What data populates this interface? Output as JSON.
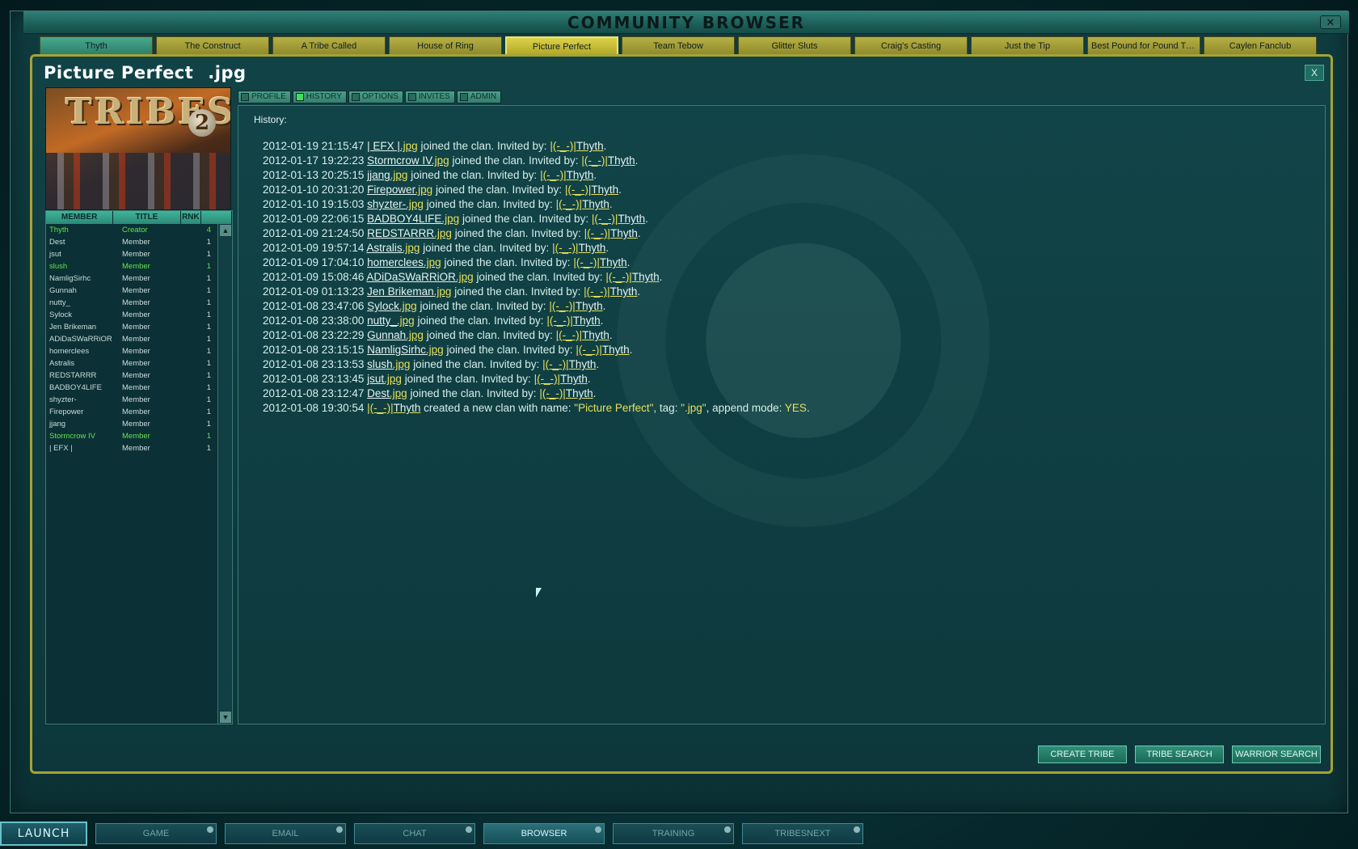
{
  "window": {
    "title": "COMMUNITY BROWSER"
  },
  "tribe_tabs": [
    "Thyth",
    "The Construct",
    "A Tribe Called",
    "House of Ring",
    "Picture Perfect",
    "Team Tebow",
    "Glitter Sluts",
    "Craig's Casting",
    "Just the Tip",
    "Best Pound for Pound Trib...",
    "Caylen Fanclub"
  ],
  "panel": {
    "name": "Picture Perfect",
    "tag": ".jpg",
    "close_label": "X"
  },
  "logo": {
    "text": "TRIBES",
    "number": "2"
  },
  "members": {
    "headers": {
      "member": "MEMBER",
      "title": "TITLE",
      "rank": "RNK"
    },
    "rows": [
      {
        "name": "Thyth",
        "title": "Creator",
        "rank": "4",
        "highlight": true
      },
      {
        "name": "Dest",
        "title": "Member",
        "rank": "1",
        "highlight": false
      },
      {
        "name": "jsut",
        "title": "Member",
        "rank": "1",
        "highlight": false
      },
      {
        "name": "slush",
        "title": "Member",
        "rank": "1",
        "highlight": true
      },
      {
        "name": "NamligSirhc",
        "title": "Member",
        "rank": "1",
        "highlight": false
      },
      {
        "name": "Gunnah",
        "title": "Member",
        "rank": "1",
        "highlight": false
      },
      {
        "name": "nutty_",
        "title": "Member",
        "rank": "1",
        "highlight": false
      },
      {
        "name": "Sylock",
        "title": "Member",
        "rank": "1",
        "highlight": false
      },
      {
        "name": "Jen Brikeman",
        "title": "Member",
        "rank": "1",
        "highlight": false
      },
      {
        "name": "ADiDaSWaRRiOR",
        "title": "Member",
        "rank": "1",
        "highlight": false
      },
      {
        "name": "homerclees",
        "title": "Member",
        "rank": "1",
        "highlight": false
      },
      {
        "name": "Astralis",
        "title": "Member",
        "rank": "1",
        "highlight": false
      },
      {
        "name": "REDSTARRR",
        "title": "Member",
        "rank": "1",
        "highlight": false
      },
      {
        "name": "BADBOY4LIFE",
        "title": "Member",
        "rank": "1",
        "highlight": false
      },
      {
        "name": "shyzter-",
        "title": "Member",
        "rank": "1",
        "highlight": false
      },
      {
        "name": "Firepower",
        "title": "Member",
        "rank": "1",
        "highlight": false
      },
      {
        "name": "jjang",
        "title": "Member",
        "rank": "1",
        "highlight": false
      },
      {
        "name": "Stormcrow IV",
        "title": "Member",
        "rank": "1",
        "highlight": true
      },
      {
        "name": "| EFX |",
        "title": "Member",
        "rank": "1",
        "highlight": false
      }
    ]
  },
  "subtabs": [
    {
      "label": "PROFILE",
      "active": false
    },
    {
      "label": "HISTORY",
      "active": true
    },
    {
      "label": "OPTIONS",
      "active": false
    },
    {
      "label": "INVITES",
      "active": false
    },
    {
      "label": "ADMIN",
      "active": false
    }
  ],
  "history": {
    "label": "History:",
    "inviter_prefix": "|(-_-)|",
    "inviter_name": "Thyth",
    "entries": [
      {
        "time": "2012-01-19 21:15:47",
        "user": "| EFX |",
        "tag": ".jpg"
      },
      {
        "time": "2012-01-17 19:22:23",
        "user": "Stormcrow IV",
        "tag": ".jpg"
      },
      {
        "time": "2012-01-13 20:25:15",
        "user": "jjang",
        "tag": ".jpg"
      },
      {
        "time": "2012-01-10 20:31:20",
        "user": "Firepower",
        "tag": ".jpg"
      },
      {
        "time": "2012-01-10 19:15:03",
        "user": "shyzter-",
        "tag": ".jpg"
      },
      {
        "time": "2012-01-09 22:06:15",
        "user": "BADBOY4LIFE",
        "tag": ".jpg"
      },
      {
        "time": "2012-01-09 21:24:50",
        "user": "REDSTARRR",
        "tag": ".jpg"
      },
      {
        "time": "2012-01-09 19:57:14",
        "user": "Astralis",
        "tag": ".jpg"
      },
      {
        "time": "2012-01-09 17:04:10",
        "user": "homerclees",
        "tag": ".jpg"
      },
      {
        "time": "2012-01-09 15:08:46",
        "user": "ADiDaSWaRRiOR",
        "tag": ".jpg"
      },
      {
        "time": "2012-01-09 01:13:23",
        "user": "Jen Brikeman",
        "tag": ".jpg"
      },
      {
        "time": "2012-01-08 23:47:06",
        "user": "Sylock",
        "tag": ".jpg"
      },
      {
        "time": "2012-01-08 23:38:00",
        "user": "nutty_",
        "tag": ".jpg"
      },
      {
        "time": "2012-01-08 23:22:29",
        "user": "Gunnah",
        "tag": ".jpg"
      },
      {
        "time": "2012-01-08 23:15:15",
        "user": "NamligSirhc",
        "tag": ".jpg"
      },
      {
        "time": "2012-01-08 23:13:53",
        "user": "slush",
        "tag": ".jpg"
      },
      {
        "time": "2012-01-08 23:13:45",
        "user": "jsut",
        "tag": ".jpg"
      },
      {
        "time": "2012-01-08 23:12:47",
        "user": "Dest",
        "tag": ".jpg"
      }
    ],
    "join_text": "joined the clan. Invited by:",
    "creation": {
      "time": "2012-01-08 19:30:54",
      "text1": "created a new clan with name:",
      "name": "\"Picture Perfect\"",
      "text2": ", tag:",
      "tag": "\".jpg\"",
      "text3": ", append mode:",
      "mode": "YES",
      "end": "."
    }
  },
  "actions": [
    "CREATE TRIBE",
    "TRIBE SEARCH",
    "WARRIOR SEARCH"
  ],
  "launchbar": {
    "launch_label": "LAUNCH",
    "items": [
      {
        "label": "GAME",
        "active": false
      },
      {
        "label": "EMAIL",
        "active": false
      },
      {
        "label": "CHAT",
        "active": false
      },
      {
        "label": "BROWSER",
        "active": true
      },
      {
        "label": "TRAINING",
        "active": false
      },
      {
        "label": "TRIBESNEXT",
        "active": false
      }
    ]
  }
}
